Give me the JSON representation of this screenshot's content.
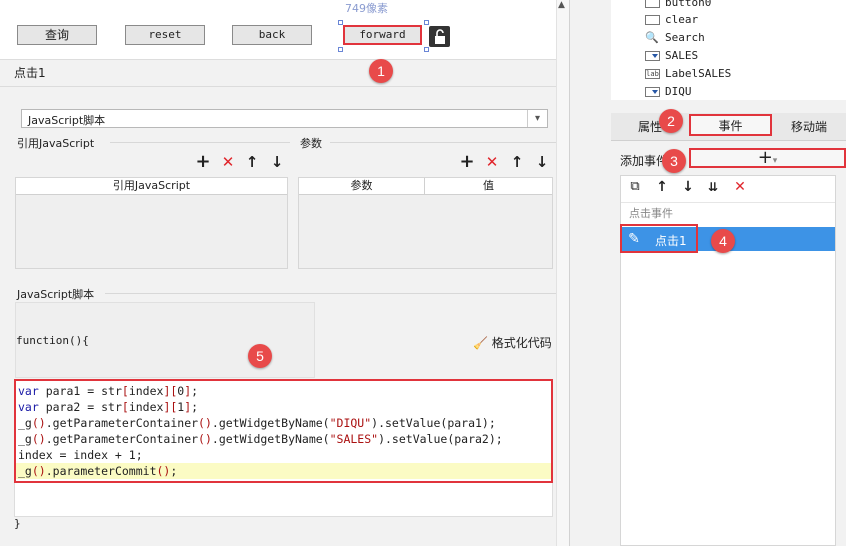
{
  "canvas": {
    "pixel_label": "749像素",
    "buttons": {
      "query": "查询",
      "reset": "reset",
      "back": "back",
      "forward": "forward"
    },
    "lock_icon": "unlock-icon"
  },
  "event_tab_label": "点击1",
  "js_editor": {
    "type_select_value": "JavaScript脚本",
    "ref_js_section": "引用JavaScript",
    "params_section": "参数",
    "ref_js_column": "引用JavaScript",
    "param_column": "参数",
    "value_column": "值",
    "script_section": "JavaScript脚本",
    "function_header": "function(){",
    "format_button": "格式化代码",
    "closing_brace": "}",
    "code_lines": [
      "var para1 = str[index][0];",
      "var para2 = str[index][1];",
      "_g().getParameterContainer().getWidgetByName(\"DIQU\").setValue(para1);",
      "_g().getParameterContainer().getWidgetByName(\"SALES\").setValue(para2);",
      "index = index + 1;",
      "_g().parameterCommit();"
    ]
  },
  "widget_list": [
    {
      "name": "button0",
      "icon": "button-icon"
    },
    {
      "name": "clear",
      "icon": "button-icon"
    },
    {
      "name": "Search",
      "icon": "search-icon"
    },
    {
      "name": "SALES",
      "icon": "combo-icon"
    },
    {
      "name": "LabelSALES",
      "icon": "label-icon"
    },
    {
      "name": "DIQU",
      "icon": "combo-icon"
    }
  ],
  "right_tabs": {
    "properties": "属性",
    "events": "事件",
    "mobile": "移动端"
  },
  "add_event_label": "添加事件",
  "event_group_title": "点击事件",
  "event_item": "点击1",
  "badges": [
    "1",
    "2",
    "3",
    "4",
    "5"
  ],
  "accent_colors": {
    "highlight_red": "#e1343c",
    "badge_red": "#e84a4a",
    "selection_blue": "#3d93e6"
  }
}
